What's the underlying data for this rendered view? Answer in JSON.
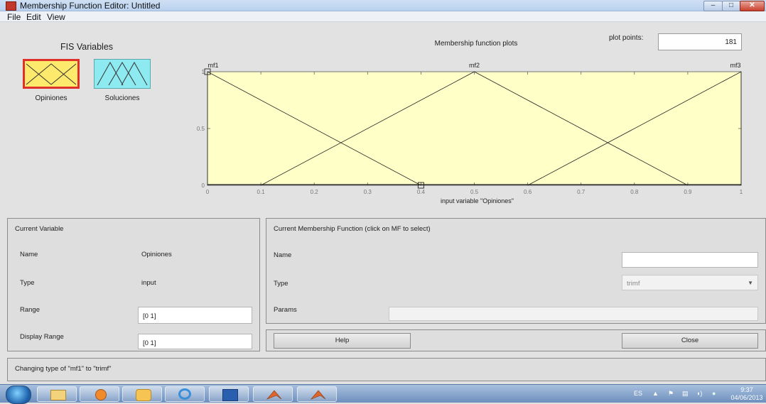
{
  "window": {
    "title": "Membership Function Editor: Untitled",
    "minimize": "–",
    "maximize": "□",
    "close": "✕"
  },
  "menu": [
    "File",
    "Edit",
    "View"
  ],
  "fis": {
    "heading": "FIS Variables",
    "variables": [
      {
        "label": "Opiniones",
        "selected": true,
        "color": "#fde96b"
      },
      {
        "label": "Soluciones",
        "selected": false,
        "color": "#8deaf0"
      }
    ]
  },
  "plot": {
    "title": "Membership function plots",
    "plot_points_label": "plot points:",
    "plot_points_value": "181",
    "xlabel": "input variable \"Opiniones\"",
    "background": "#ffffc8"
  },
  "chart_data": {
    "type": "line",
    "title": "Membership function plots",
    "xlabel": "input variable \"Opiniones\"",
    "ylabel": "",
    "xlim": [
      0,
      1
    ],
    "ylim": [
      0,
      1
    ],
    "xticks": [
      "0",
      "0.1",
      "0.2",
      "0.3",
      "0.4",
      "0.5",
      "0.6",
      "0.7",
      "0.8",
      "0.9",
      "1"
    ],
    "yticks": [
      "0",
      "0.5",
      "1"
    ],
    "series": [
      {
        "name": "mf1",
        "x": [
          0,
          0,
          0.4
        ],
        "y": [
          0,
          1,
          0
        ]
      },
      {
        "name": "mf2",
        "x": [
          0.1,
          0.5,
          0.9
        ],
        "y": [
          0,
          1,
          0
        ]
      },
      {
        "name": "mf3",
        "x": [
          0.6,
          1,
          1
        ],
        "y": [
          0,
          1,
          0
        ]
      }
    ],
    "handles": [
      {
        "x": 0,
        "y": 1
      },
      {
        "x": 0.4,
        "y": 0
      }
    ]
  },
  "current_variable": {
    "title": "Current Variable",
    "name_label": "Name",
    "name_value": "Opiniones",
    "type_label": "Type",
    "type_value": "input",
    "range_label": "Range",
    "range_value": "[0 1]",
    "display_range_label": "Display Range",
    "display_range_value": "[0 1]"
  },
  "current_mf": {
    "title": "Current Membership Function (click on MF to select)",
    "name_label": "Name",
    "name_value": "",
    "type_label": "Type",
    "type_value": "trimf",
    "params_label": "Params",
    "params_value": ""
  },
  "buttons": {
    "help": "Help",
    "close": "Close"
  },
  "status": "Changing type of \"mf1\" to \"trimf\"",
  "taskbar": {
    "lang": "ES",
    "time": "9:37",
    "date": "04/06/2013"
  }
}
